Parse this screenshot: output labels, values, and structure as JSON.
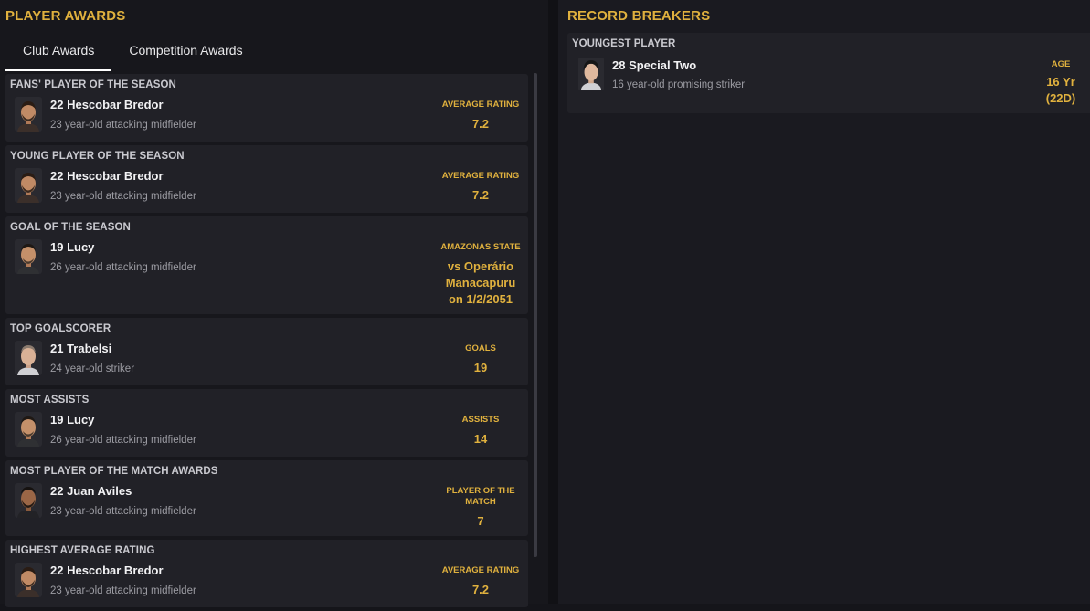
{
  "left_panel": {
    "title": "PLAYER AWARDS",
    "tabs": [
      {
        "label": "Club Awards",
        "active": true
      },
      {
        "label": "Competition Awards",
        "active": false
      }
    ],
    "awards": [
      {
        "title": "FANS' PLAYER OF THE SEASON",
        "player": "22 Hescobar Bredor",
        "desc": "23 year-old attacking midfielder",
        "stat_label": "AVERAGE RATING",
        "stat_value": "7.2"
      },
      {
        "title": "YOUNG PLAYER OF THE SEASON",
        "player": "22 Hescobar Bredor",
        "desc": "23 year-old attacking midfielder",
        "stat_label": "AVERAGE RATING",
        "stat_value": "7.2"
      },
      {
        "title": "GOAL OF THE SEASON",
        "player": "19 Lucy",
        "desc": "26 year-old attacking midfielder",
        "stat_label": "AMAZONAS STATE",
        "stat_value": "vs Operário Manacapuru on 1/2/2051"
      },
      {
        "title": "TOP GOALSCORER",
        "player": "21 Trabelsi",
        "desc": "24 year-old striker",
        "stat_label": "GOALS",
        "stat_value": "19"
      },
      {
        "title": "MOST ASSISTS",
        "player": "19 Lucy",
        "desc": "26 year-old attacking midfielder",
        "stat_label": "ASSISTS",
        "stat_value": "14"
      },
      {
        "title": "MOST PLAYER OF THE MATCH AWARDS",
        "player": "22 Juan Aviles",
        "desc": "23 year-old attacking midfielder",
        "stat_label": "PLAYER OF THE MATCH",
        "stat_value": "7"
      },
      {
        "title": "HIGHEST AVERAGE RATING",
        "player": "22 Hescobar Bredor",
        "desc": "23 year-old attacking midfielder",
        "stat_label": "AVERAGE RATING",
        "stat_value": "7.2"
      }
    ]
  },
  "right_panel": {
    "title": "RECORD BREAKERS",
    "records": [
      {
        "title": "YOUNGEST PLAYER",
        "player": "28 Special Two",
        "desc": "16 year-old promising striker",
        "stat_label": "AGE",
        "stat_value": "16 Yr (22D)"
      }
    ]
  },
  "colors": {
    "accent": "#e0b13e",
    "card": "#212127",
    "background": "#17171c"
  },
  "icons": [
    "player-face-icon"
  ]
}
